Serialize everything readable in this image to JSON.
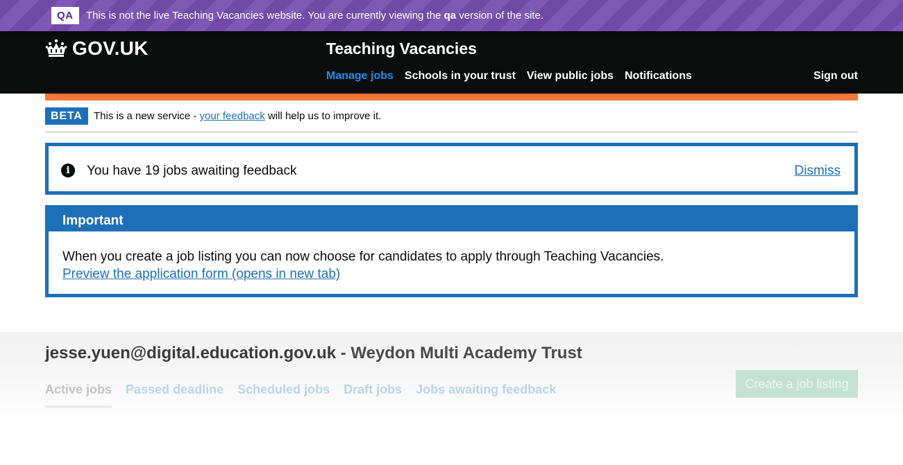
{
  "env_banner": {
    "tag": "QA",
    "text_before": "This is not the live Teaching Vacancies website. You are currently viewing the ",
    "env_name": "qa",
    "text_after": " version of the site."
  },
  "header": {
    "logo_text": "GOV.UK",
    "service_name": "Teaching Vacancies",
    "nav": [
      "Manage jobs",
      "Schools in your trust",
      "View public jobs",
      "Notifications"
    ],
    "active_nav": "Manage jobs",
    "sign_out": "Sign out"
  },
  "beta_banner": {
    "tag": "BETA",
    "text_before": "This is a new service - ",
    "link": "your feedback",
    "text_after": " will help us to improve it."
  },
  "notice": {
    "icon": "info-icon",
    "text": "You have 19 jobs awaiting feedback",
    "dismiss": "Dismiss"
  },
  "important": {
    "title": "Important",
    "body": "When you create a job listing you can now choose for candidates to apply through Teaching Vacancies.",
    "link": "Preview the application form (opens in new tab)"
  },
  "dashboard": {
    "email": "jesse.yuen@digital.education.gov.uk",
    "separator": " - ",
    "organisation": "Weydon Multi Academy Trust",
    "tabs": [
      "Active jobs",
      "Passed deadline",
      "Scheduled jobs",
      "Draft jobs",
      "Jobs awaiting feedback"
    ],
    "active_tab": "Active jobs",
    "create_button": "Create a job listing"
  },
  "colors": {
    "brand_blue": "#1d70b8",
    "nav_active": "#1d8feb",
    "orange_stripe": "#f47738",
    "qa_purple": "#6f4aa6",
    "header_black": "#0b0c0c"
  }
}
